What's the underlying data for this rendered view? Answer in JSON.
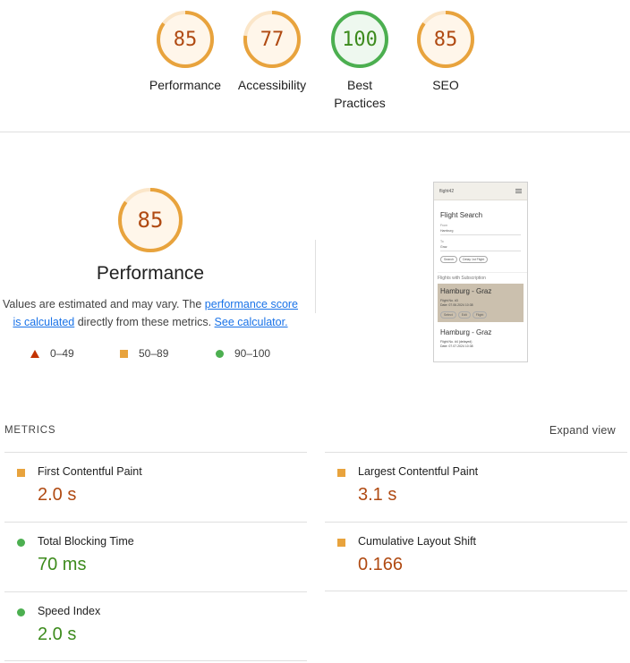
{
  "scores": [
    {
      "value": "85",
      "label": "Performance",
      "status": "average"
    },
    {
      "value": "77",
      "label": "Accessibility",
      "status": "average"
    },
    {
      "value": "100",
      "label": "Best Practices",
      "status": "pass"
    },
    {
      "value": "85",
      "label": "SEO",
      "status": "average"
    }
  ],
  "performance": {
    "score": "85",
    "title": "Performance",
    "desc_prefix": "Values are estimated and may vary. The ",
    "desc_link1": "performance score is calculated",
    "desc_middle": " directly from these metrics. ",
    "desc_link2": "See calculator."
  },
  "legend": [
    {
      "range": "0–49",
      "shape": "triangle",
      "color": "#c33300"
    },
    {
      "range": "50–89",
      "shape": "square",
      "color": "#e8a33d"
    },
    {
      "range": "90–100",
      "shape": "circle",
      "color": "#4caf50"
    }
  ],
  "thumbnail": {
    "app_name": "flight42",
    "heading": "Flight Search",
    "from_label": "From",
    "from_value": "Hamburg",
    "to_label": "To",
    "to_value": "Graz",
    "search_btn": "Search",
    "delay_btn": "Delay 1st Flight",
    "section_title": "Flights with Subscription",
    "flight1_title": "Hamburg - Graz",
    "flight1_no": "Flight No. #3",
    "flight1_date": "Date: 07.06.2024 10:38",
    "flight1_btns": [
      "Select",
      "Edit",
      "Flight"
    ],
    "flight2_title": "Hamburg - Graz",
    "flight2_no": "Flight No. #4 (delayed)",
    "flight2_date": "Date: 07.07.2024 10:38"
  },
  "metrics": {
    "heading": "METRICS",
    "expand": "Expand view",
    "items": [
      {
        "name": "First Contentful Paint",
        "value": "2.0 s",
        "status": "average"
      },
      {
        "name": "Largest Contentful Paint",
        "value": "3.1 s",
        "status": "average"
      },
      {
        "name": "Total Blocking Time",
        "value": "70 ms",
        "status": "pass"
      },
      {
        "name": "Cumulative Layout Shift",
        "value": "0.166",
        "status": "average"
      },
      {
        "name": "Speed Index",
        "value": "2.0 s",
        "status": "pass"
      }
    ]
  },
  "colors": {
    "average_arc": "#e8a33d",
    "average_fill": "#fff6ea",
    "average_text": "#b04a12",
    "pass_arc": "#4caf50",
    "pass_fill": "#eef8ef",
    "pass_text": "#3d8b1d"
  }
}
